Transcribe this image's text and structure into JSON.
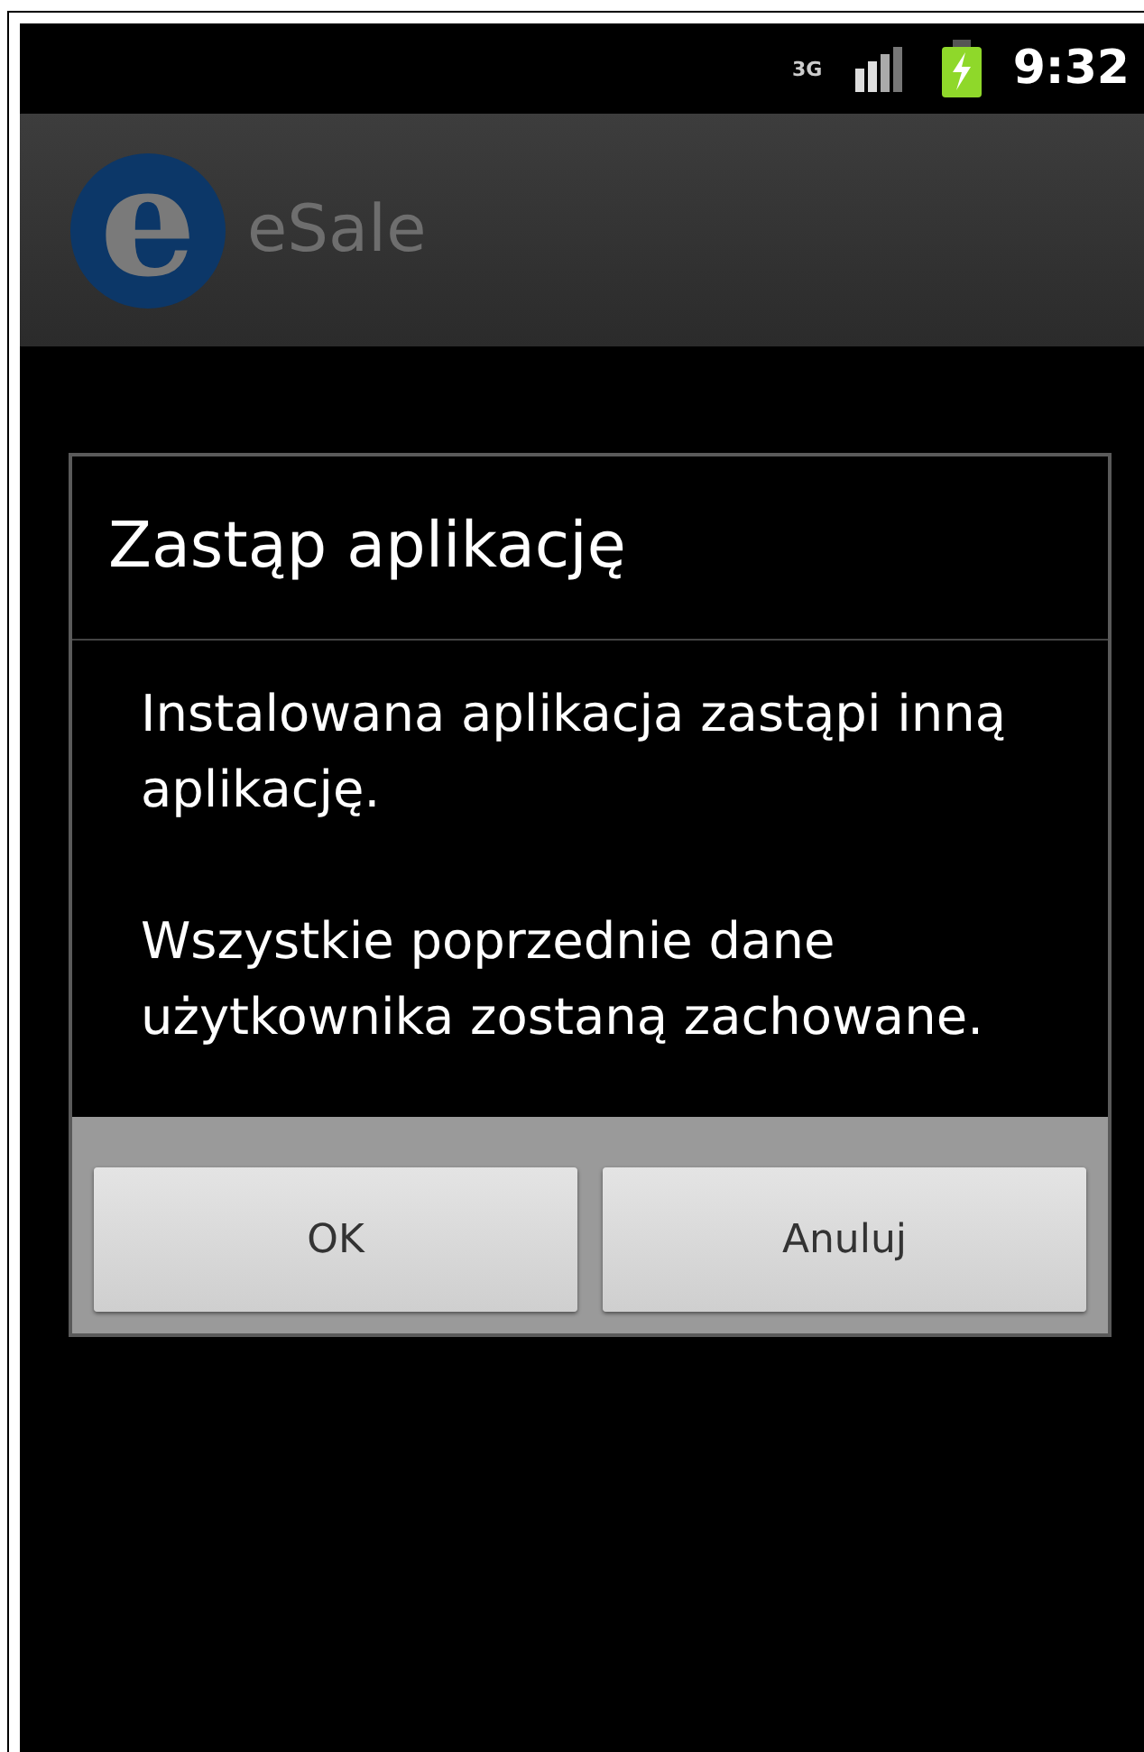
{
  "status_bar": {
    "network": "3G",
    "time": "9:32"
  },
  "action_bar": {
    "logo": "e",
    "title": "eSale"
  },
  "dialog": {
    "title": "Zastąp aplikację",
    "paragraphs": [
      "Instalowana aplikacja zastąpi inną aplikację.",
      "Wszystkie poprzednie dane użytkownika zostaną zachowane."
    ],
    "buttons": [
      "OK",
      "Anuluj"
    ]
  }
}
